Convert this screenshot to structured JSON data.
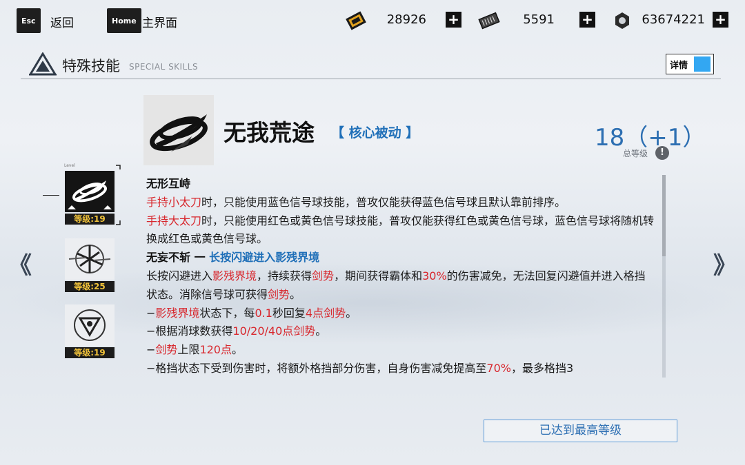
{
  "topbar": {
    "esc_key": "Esc",
    "back_label": "返回",
    "home_key": "Home",
    "home_label": "主界面",
    "currencies": [
      {
        "icon": "gold-card-icon",
        "value": "28926"
      },
      {
        "icon": "chip-icon",
        "value": "5591"
      },
      {
        "icon": "nut-icon",
        "value": "63674221"
      }
    ],
    "plus_glyph": "+"
  },
  "header": {
    "title": "特殊技能",
    "subtitle": "SPECIAL SKILLS",
    "detail_label": "详情",
    "detail_toggle_on": true
  },
  "skill": {
    "name": "无我荒途",
    "type": "【 核心被动 】",
    "total_level": "18（+1）",
    "total_level_label": "总等级",
    "info_glyph": "!"
  },
  "skill_list": {
    "level_caption": "Level",
    "items": [
      {
        "level": "等级:19",
        "selected": true
      },
      {
        "level": "等级:25",
        "selected": false
      },
      {
        "level": "等级:19",
        "selected": false
      }
    ]
  },
  "nav": {
    "prev": "《",
    "next": "》"
  },
  "description": {
    "s1_title": "无形互峙",
    "s1_l1_red": "手持小太刀",
    "s1_l1_rest": "时，只能使用蓝色信号球技能，普攻仅能获得蓝色信号球且默认靠前排序。",
    "s1_l2_red": "手持大太刀",
    "s1_l2_rest": "时，只能使用红色或黄色信号球技能，普攻仅能获得红色或黄色信号球，蓝色信号球将随机转换成红色或黄色信号球。",
    "s2_title": "无妄不斩 一 ",
    "s2_title_blue": "长按闪避进入影残界境",
    "p1_a": "长按闪避进入",
    "p1_b": "影残界境",
    "p1_c": "，持续获得",
    "p1_d": "剑势",
    "p1_e": "，期间获得霸体和",
    "p1_f": "30%",
    "p1_g": "的伤害减免，无法回复闪避值并进入格挡状态。消除信号球可获得",
    "p1_h": "剑势",
    "p1_i": "。",
    "p2_a": "−",
    "p2_b": "影残界境",
    "p2_c": "状态下，每",
    "p2_d": "0.1",
    "p2_e": "秒回复",
    "p2_f": "4点剑势",
    "p2_g": "。",
    "p3_a": "−根据消球数获得",
    "p3_b": "10/20/40点剑势",
    "p3_c": "。",
    "p4_a": "−",
    "p4_b": "剑势",
    "p4_c": "上限",
    "p4_d": "120点",
    "p4_e": "。",
    "p5_a": "−格挡状态下受到伤害时，将额外格挡部分伤害，自身伤害减免提高至",
    "p5_b": "70%",
    "p5_c": "，最多格挡3"
  },
  "footer": {
    "max_level_label": "已达到最高等级"
  },
  "colors": {
    "accent_blue": "#1f6fb8",
    "highlight_red": "#d8272d",
    "level_gold": "#f0c23a",
    "toggle_blue": "#33a7f2"
  }
}
